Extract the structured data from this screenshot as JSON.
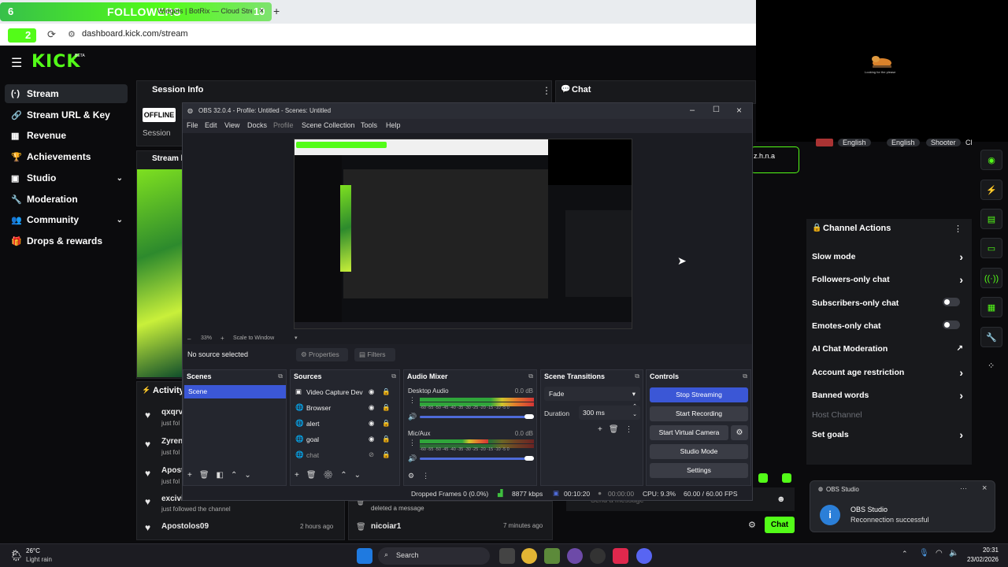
{
  "browser": {
    "tab_title": "Widgets | BotRix — Cloud Strea",
    "tab_close": "×",
    "new_tab": "+",
    "url": "dashboard.kick.com/stream",
    "overlay": {
      "left_count": "6",
      "label": "FOLLOWERS",
      "right_count": "10",
      "sub_count": "2"
    }
  },
  "cam_caption": "Looking for the please",
  "kick": {
    "logo": "KICK",
    "beta": "BETA",
    "sidebar": [
      {
        "label": "Stream",
        "icon": "(·)",
        "active": true
      },
      {
        "label": "Stream URL & Key",
        "icon": "🔗"
      },
      {
        "label": "Revenue",
        "icon": "▦"
      },
      {
        "label": "Achievements",
        "icon": "🏆"
      },
      {
        "label": "Studio",
        "icon": "▣",
        "chevron": "⌄"
      },
      {
        "label": "Moderation",
        "icon": "🔧"
      },
      {
        "label": "Community",
        "icon": "👥",
        "chevron": "⌄"
      },
      {
        "label": "Drops & rewards",
        "icon": "🎁"
      }
    ],
    "session_info": {
      "title": "Session Info",
      "status": "OFFLINE",
      "session_label": "Session",
      "menu": "⋮"
    },
    "stream_preview_label": "Stream l",
    "chat": {
      "title": "Chat",
      "user": "z.h.n.a",
      "placeholder": "Send a message",
      "send": "Chat"
    },
    "tags": [
      "English",
      "English",
      "Shooter",
      "Cl"
    ],
    "activity": {
      "title": "Activity",
      "items": [
        {
          "name": "qxqrv",
          "desc": "just fol",
          "time": ""
        },
        {
          "name": "Zyren",
          "desc": "just fol",
          "time": ""
        },
        {
          "name": "Apost",
          "desc": "just fol",
          "time": ""
        },
        {
          "name": "excivi",
          "desc": "just followed the channel",
          "time": ""
        },
        {
          "name": "Apostolos09",
          "desc": "just followed the channel",
          "time": "2 hours ago"
        }
      ],
      "mod_items": [
        {
          "name": "",
          "desc": "deleted a message",
          "time": ""
        },
        {
          "name": "nicoiar1",
          "desc": "",
          "time": "7 minutes ago"
        }
      ]
    },
    "channel_actions": {
      "title": "Channel Actions",
      "menu": "⋮",
      "rows": [
        {
          "label": "Slow mode",
          "control": "chevron"
        },
        {
          "label": "Followers-only chat",
          "control": "chevron"
        },
        {
          "label": "Subscribers-only chat",
          "control": "toggle"
        },
        {
          "label": "Emotes-only chat",
          "control": "toggle"
        },
        {
          "label": "AI Chat Moderation",
          "control": "external"
        },
        {
          "label": "Account age restriction",
          "control": "chevron"
        },
        {
          "label": "Banned words",
          "control": "chevron"
        },
        {
          "label": "Host Channel",
          "control": "none",
          "disabled": true
        },
        {
          "label": "Set goals",
          "control": "chevron"
        }
      ]
    }
  },
  "obs": {
    "title": "OBS 32.0.4 - Profile: Untitled - Scenes: Untitled",
    "menu": [
      "File",
      "Edit",
      "View",
      "Docks",
      "Profile",
      "Scene Collection",
      "Tools",
      "Help"
    ],
    "zoom": "33%",
    "zoom_mode": "Scale to Window",
    "no_source": "No source selected",
    "properties": "Properties",
    "filters": "Filters",
    "scenes": {
      "title": "Scenes",
      "items": [
        "Scene"
      ]
    },
    "sources": {
      "title": "Sources",
      "items": [
        "Video Capture Dev",
        "Browser",
        "alert",
        "goal",
        "chat"
      ]
    },
    "audio_mixer": {
      "title": "Audio Mixer",
      "channels": [
        {
          "name": "Desktop Audio",
          "db": "0.0 dB",
          "level": 0.96
        },
        {
          "name": "Mic/Aux",
          "db": "0.0 dB",
          "level": 0.6
        }
      ],
      "scale": "-60 -55 -50 -45 -40 -35 -30 -25 -20 -15 -10 -5 0"
    },
    "scene_transitions": {
      "title": "Scene Transitions",
      "transition": "Fade",
      "duration_label": "Duration",
      "duration": "300 ms"
    },
    "controls": {
      "title": "Controls",
      "buttons": [
        "Stop Streaming",
        "Start Recording",
        "Start Virtual Camera",
        "Studio Mode",
        "Settings"
      ]
    },
    "status": {
      "dropped": "Dropped Frames 0 (0.0%)",
      "bitrate": "8877 kbps",
      "live": "00:10:20",
      "rec": "00:00:00",
      "cpu": "CPU: 9.3%",
      "fps": "60.00 / 60.00 FPS"
    }
  },
  "notification": {
    "app": "OBS Studio",
    "title": "OBS Studio",
    "body": "Reconnection successful",
    "menu": "···",
    "close": "×"
  },
  "taskbar": {
    "weather_temp": "26°C",
    "weather_desc": "Light rain",
    "search": "Search",
    "time": "20:31",
    "date": "23/02/2026"
  }
}
